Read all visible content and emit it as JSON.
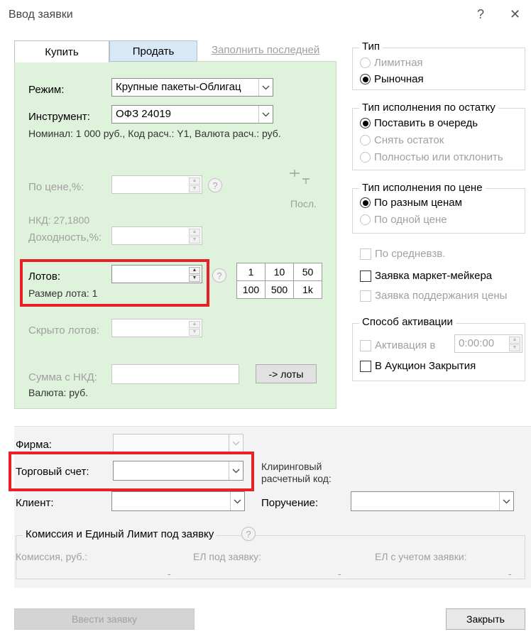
{
  "window": {
    "title": "Ввод заявки",
    "help_glyph": "?",
    "close_glyph": "✕"
  },
  "tabs": {
    "buy": "Купить",
    "sell": "Продать",
    "fill_last": "Заполнить последней"
  },
  "order": {
    "mode_label": "Режим:",
    "mode_value": "Крупные пакеты-Облигац",
    "instrument_label": "Инструмент:",
    "instrument_value": "ОФЗ 24019",
    "nominal_info": "Номинал: 1 000 руб., Код расч.: Y1, Валюта расч.: руб.",
    "price_label": "По цене,%:",
    "last_label": "Посл.",
    "nkd_info": "НКД: 27,1800",
    "yield_label": "Доходность,%:",
    "lots_label": "Лотов:",
    "lot_size_info": "Размер лота: 1",
    "hidden_lots_label": "Скрыто лотов:",
    "sum_nkd_label": "Сумма с НКД:",
    "to_lots_button": "-> лоты",
    "currency_info": "Валюта: руб.",
    "lot_grid": [
      [
        "1",
        "10",
        "50"
      ],
      [
        "100",
        "500",
        "1k"
      ]
    ]
  },
  "type_group": {
    "title": "Тип",
    "options": [
      {
        "label": "Лимитная",
        "selected": false,
        "enabled": false
      },
      {
        "label": "Рыночная",
        "selected": true,
        "enabled": true
      }
    ]
  },
  "rest_group": {
    "title": "Тип исполнения по остатку",
    "options": [
      {
        "label": "Поставить в очередь",
        "selected": true,
        "enabled": true
      },
      {
        "label": "Снять остаток",
        "selected": false,
        "enabled": false
      },
      {
        "label": "Полностью или отклонить",
        "selected": false,
        "enabled": false
      }
    ]
  },
  "price_exec_group": {
    "title": "Тип исполнения по цене",
    "options": [
      {
        "label": "По разным ценам",
        "selected": true,
        "enabled": true
      },
      {
        "label": "По одной цене",
        "selected": false,
        "enabled": false
      }
    ]
  },
  "checks": {
    "weighted": "По средневзв.",
    "market_maker": "Заявка маркет-мейкера",
    "price_support": "Заявка поддержания цены"
  },
  "activation_group": {
    "title": "Способ активации",
    "activate_at": "Активация в",
    "time_value": "0:00:00",
    "closing_auction": "В Аукцион Закрытия"
  },
  "account": {
    "firm_label": "Фирма:",
    "account_label": "Торговый счет:",
    "clearing_label_1": "Клиринговый",
    "clearing_label_2": "расчетный код:",
    "client_label": "Клиент:",
    "instruction_label": "Поручение:"
  },
  "commission": {
    "title": "Комиссия и Единый Лимит под заявку",
    "commission_label": "Комиссия, руб.:",
    "el_label": "ЕЛ под заявку:",
    "el_with_label": "ЕЛ с учетом заявки:",
    "dash": "-"
  },
  "footer": {
    "submit": "Ввести заявку",
    "close": "Закрыть"
  },
  "icons": {
    "help": "?",
    "dropdown": "chevron-down-icon",
    "spin_up": "▲",
    "spin_down": "▼",
    "last_price": "last-price-icon"
  }
}
